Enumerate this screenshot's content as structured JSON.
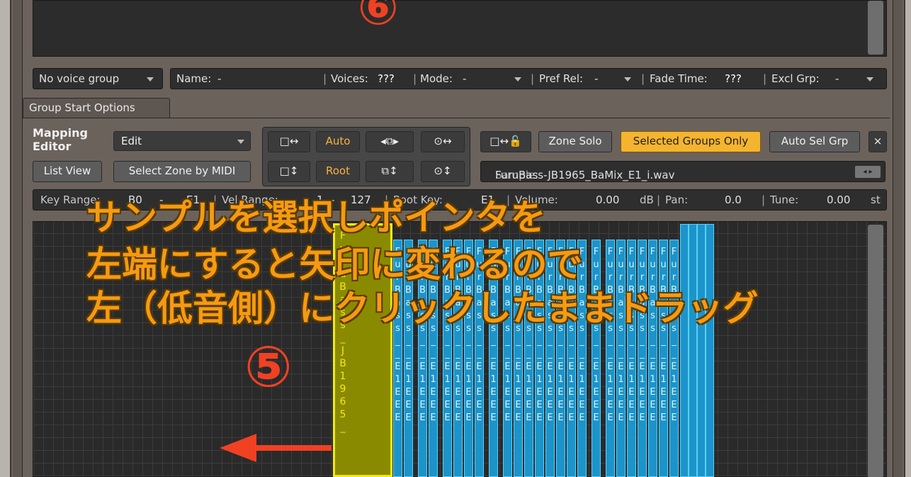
{
  "annotations": {
    "step_top": "⑥",
    "step_main": "⑤",
    "line1": "サンプルを選択しポインタを",
    "line2": "左端にすると矢印に変わるので",
    "line3": "左（低音側）にクリックしたままドラッグ"
  },
  "group_bar": {
    "voice_group": "No voice group",
    "name_label": "Name:",
    "name_value": "-",
    "voices_label": "Voices:",
    "voices_value": "???",
    "mode_label": "Mode:",
    "mode_value": "-",
    "pref_rel_label": "Pref Rel:",
    "pref_rel_value": "-",
    "fade_label": "Fade Time:",
    "fade_value": "???",
    "excl_label": "Excl Grp:",
    "excl_value": "-"
  },
  "tabs": {
    "group_start": "Group Start Options"
  },
  "mapping_editor": {
    "title_line1": "Mapping",
    "title_line2": "Editor",
    "edit_dropdown": "Edit",
    "list_view": "List View",
    "select_zone_midi": "Select Zone by MIDI",
    "h_expand": "□↔",
    "v_expand": "□↕",
    "auto": "Auto",
    "root": "Root",
    "move_lr": "◂⧉▸",
    "move_ud": "⧉↕",
    "link_lr": "⊙↔",
    "link_ud": "⊙↕",
    "lock": "□↔🔓",
    "zone_solo": "Zone Solo",
    "selected_groups_only": "Selected Groups Only",
    "auto_sel_grp": "Auto Sel Grp",
    "close": "×",
    "sample_label": "Sample:",
    "sample_value": "FuruBass-JB1965_BaMix_E1_i.wav",
    "sample_nav": "◂ ▸"
  },
  "key_bar": {
    "key_range_label": "Key Range:",
    "key_low": "B0",
    "key_dash": "-",
    "key_high": "E1",
    "vel_range_label": "Vel Range:",
    "vel_low": "1",
    "vel_dash": "-",
    "vel_high": "127",
    "root_key_label": "Root Key:",
    "root_key_value": "E1",
    "volume_label": "Volume:",
    "volume_value": "0.00",
    "volume_unit": "dB",
    "pan_label": "Pan:",
    "pan_value": "0.0",
    "tune_label": "Tune:",
    "tune_value": "0.00",
    "tune_unit": "st"
  },
  "zones": {
    "selected_name": "FuruBass_JB1965_",
    "zone_name": "FurBass__E1EEE"
  },
  "colors": {
    "accent_orange": "#f59a13",
    "step_red": "#f04123",
    "zone_blue": "#1d94c9",
    "selected_yellow": "#f2ea14",
    "highlight_button": "#f5b42f"
  }
}
